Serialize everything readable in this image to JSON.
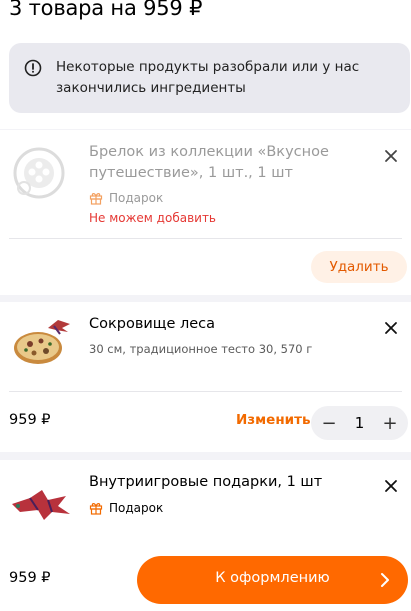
{
  "header": {
    "title": "3 товара на 959 ₽",
    "notice": "Некоторые продукты разобрали или у нас закончились ингредиенты"
  },
  "items": [
    {
      "name": "Брелок из коллекции «Вкусное путешествие», 1 шт., 1 шт",
      "tag": "Подарок",
      "error": "Не можем добавить",
      "remove_label": "Удалить"
    },
    {
      "name": "Сокровище леса",
      "description": "30 см, традиционное тесто 30, 570 г",
      "price": "959 ₽",
      "change_label": "Изменить",
      "quantity": "1",
      "minus": "−",
      "plus": "+"
    },
    {
      "name": "Внутриигровые подарки, 1 шт",
      "tag": "Подарок"
    }
  ],
  "footer": {
    "total": "959 ₽",
    "checkout_label": "К оформлению"
  },
  "colors": {
    "accent": "#ff6900",
    "error": "#e53935",
    "background": "#f3f3f7"
  },
  "icons": [
    "info-icon",
    "close-icon",
    "gift-icon",
    "chevron-right-icon",
    "keychain-image",
    "pizza-image",
    "dragon-image"
  ]
}
